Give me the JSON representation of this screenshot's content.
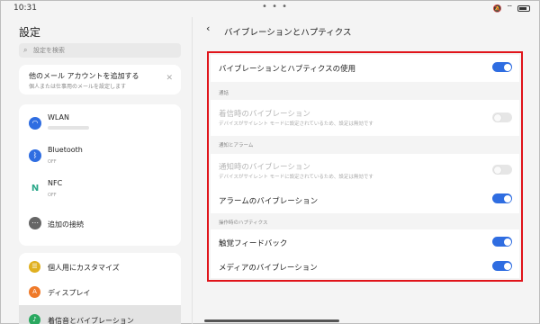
{
  "status_bar": {
    "time": "10:31",
    "dots": "• • •"
  },
  "left": {
    "title": "設定",
    "search_placeholder": "設定を検索",
    "add_account": {
      "title": "他のメール アカウントを追加する",
      "subtitle": "個人または仕事用のメールを設定します"
    },
    "network_items": [
      {
        "label": "WLAN",
        "icon": "wifi-icon",
        "sub": ""
      },
      {
        "label": "Bluetooth",
        "icon": "bluetooth-icon",
        "sub": "OFF"
      },
      {
        "label": "NFC",
        "icon": "nfc-icon",
        "sub": "OFF"
      },
      {
        "label": "追加の接続",
        "icon": "more-icon",
        "sub": ""
      }
    ],
    "personal_items": [
      {
        "label": "個人用にカスタマイズ",
        "icon": "customize-icon"
      },
      {
        "label": "ディスプレイ",
        "icon": "display-icon"
      },
      {
        "label": "着信音とバイブレーション",
        "icon": "sound-icon"
      }
    ]
  },
  "right": {
    "title": "バイブレーションとハプティクス",
    "main_toggle": {
      "label": "バイブレーションとハプティクスの使用",
      "on": true
    },
    "section_call": "通話",
    "ringtone_vibration": {
      "label": "着信時のバイブレーション",
      "sub": "デバイスがサイレント モードに設定されているため、設定は無効です",
      "on": false
    },
    "section_notification": "通知とアラーム",
    "notification_vibration": {
      "label": "通知時のバイブレーション",
      "sub": "デバイスがサイレント モードに設定されているため、設定は無効です",
      "on": false
    },
    "alarm_vibration": {
      "label": "アラームのバイブレーション",
      "on": true
    },
    "section_haptics": "操作時のハプティクス",
    "touch_feedback": {
      "label": "触覚フィードバック",
      "on": true
    },
    "media_vibration": {
      "label": "メディアのバイブレーション",
      "on": true
    }
  },
  "colors": {
    "accent": "#2f6de1",
    "highlight_border": "#e0141a"
  }
}
